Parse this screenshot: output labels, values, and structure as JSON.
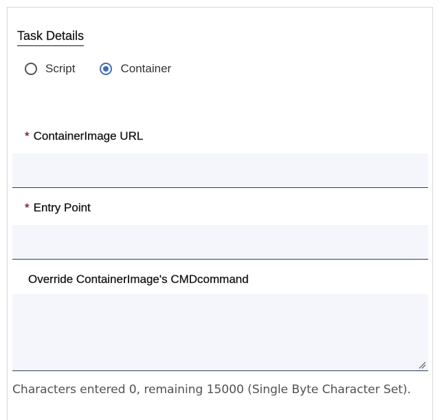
{
  "section": {
    "title": "Task Details"
  },
  "task_type": {
    "options": [
      {
        "label": "Script",
        "selected": false
      },
      {
        "label": "Container",
        "selected": true
      }
    ]
  },
  "fields": {
    "container_image_url": {
      "required_mark": "*",
      "label": "ContainerImage URL",
      "value": ""
    },
    "entry_point": {
      "required_mark": "*",
      "label": "Entry Point",
      "value": ""
    },
    "override_cmd": {
      "label": "Override ContainerImage's CMDcommand",
      "value": "",
      "helper_text": "Characters entered 0, remaining 15000 (Single Byte Character Set)."
    }
  },
  "colors": {
    "accent": "#3f6eb5",
    "required": "#da1e28",
    "input_bg": "#f4f6fb",
    "input_border": "#2d3a57"
  },
  "icons": {
    "radio_selected": "radio-selected-icon",
    "radio_unselected": "radio-unselected-icon",
    "resize": "resize-grip-icon"
  }
}
